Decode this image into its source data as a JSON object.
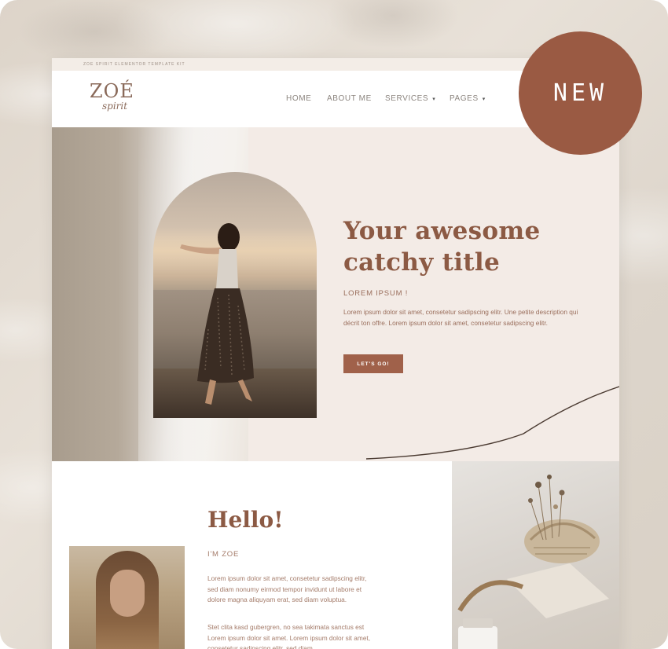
{
  "kit_label": "ZOE SPIRIT ELEMENTOR TEMPLATE KIT",
  "logo": {
    "main": "ZOÉ",
    "script": "spirit"
  },
  "nav": {
    "items": [
      {
        "label": "HOME"
      },
      {
        "label": "ABOUT ME"
      },
      {
        "label": "SERVICES",
        "chevron": "▾"
      },
      {
        "label": "PAGES",
        "chevron": "▾"
      }
    ]
  },
  "badge": {
    "label": "NEW"
  },
  "hero": {
    "title_line1": "Your awesome",
    "title_line2": "catchy title",
    "subtitle": "LOREM IPSUM !",
    "body": "Lorem ipsum dolor sit amet, consetetur sadipscing elitr. Une petite description qui décrit ton offre. Lorem ipsum dolor sit amet, consetetur sadipscing elitr.",
    "button_label": "LET'S GO!"
  },
  "about": {
    "heading": "Hello!",
    "subheading": "I'M ZOE",
    "paragraph1": "Lorem ipsum dolor sit amet, consetetur sadipscing elitr, sed diam nonumy eirmod tempor invidunt ut labore et dolore magna aliquyam erat, sed diam voluptua.",
    "paragraph2": "Stet clita kasd gubergren, no sea takimata sanctus est Lorem ipsum dolor sit amet. Lorem ipsum dolor sit amet, consetetur sadipscing elitr, sed diam"
  },
  "colors": {
    "accent": "#9a5a43",
    "heading": "#8c5a44",
    "hero_bg": "#f3ebe6"
  }
}
